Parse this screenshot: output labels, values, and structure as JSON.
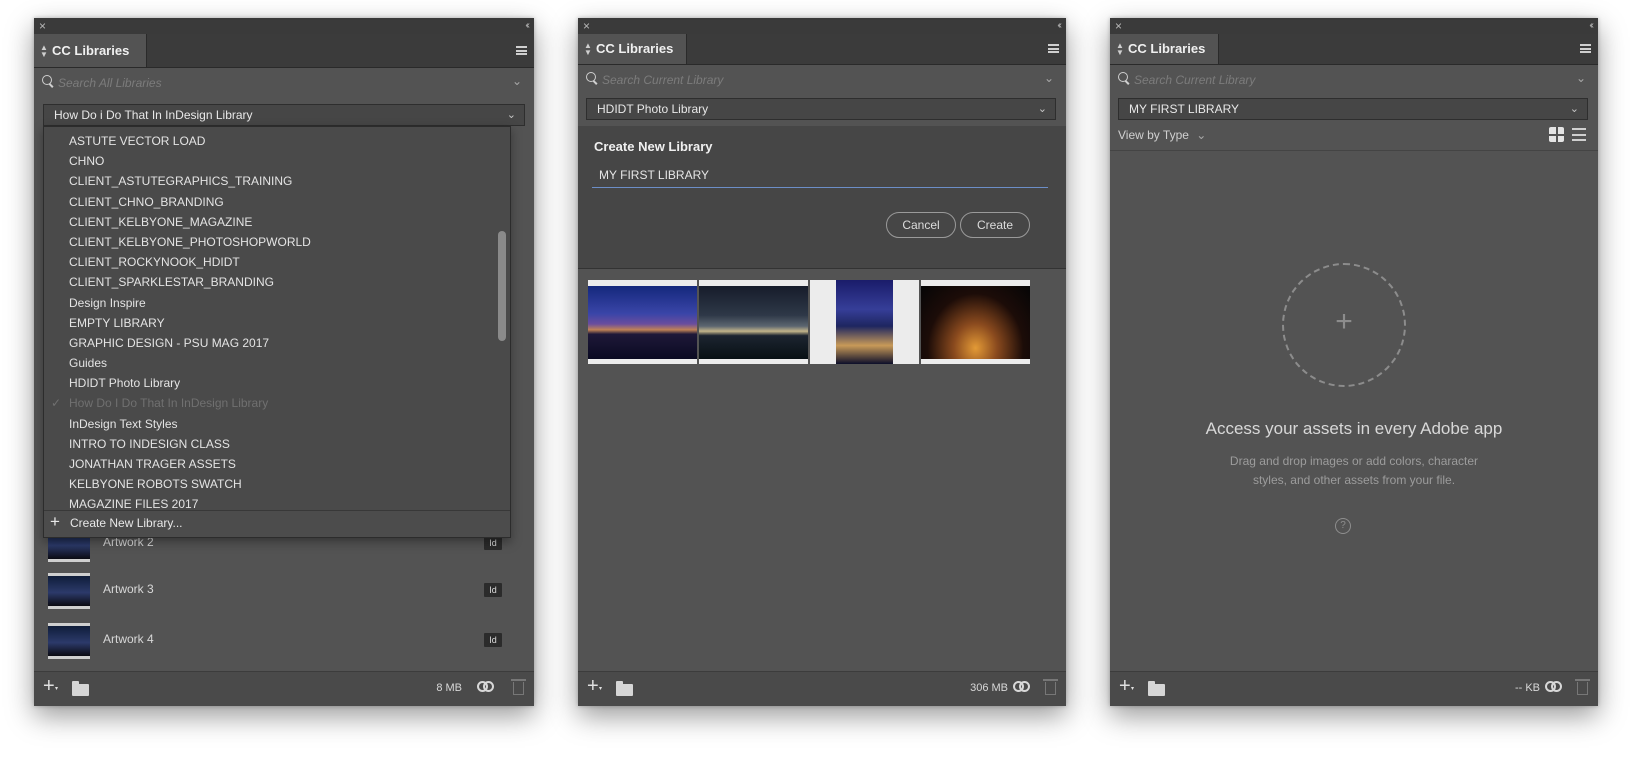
{
  "panel1": {
    "tab_label": "CC Libraries",
    "search_placeholder": "Search All Libraries",
    "selected_library": "How Do i Do That In InDesign Library",
    "dropdown_items": [
      {
        "label": "ASTUTE VECTOR LOAD"
      },
      {
        "label": "CHNO"
      },
      {
        "label": "CLIENT_ASTUTEGRAPHICS_TRAINING"
      },
      {
        "label": "CLIENT_CHNO_BRANDING"
      },
      {
        "label": "CLIENT_KELBYONE_MAGAZINE"
      },
      {
        "label": "CLIENT_KELBYONE_PHOTOSHOPWORLD"
      },
      {
        "label": "CLIENT_ROCKYNOOK_HDIDT"
      },
      {
        "label": "CLIENT_SPARKLESTAR_BRANDING"
      },
      {
        "label": "Design Inspire"
      },
      {
        "label": "EMPTY LIBRARY"
      },
      {
        "label": "GRAPHIC DESIGN - PSU MAG 2017"
      },
      {
        "label": "Guides"
      },
      {
        "label": "HDIDT Photo Library"
      },
      {
        "label": "How Do I Do That In InDesign Library",
        "checked": true
      },
      {
        "label": "InDesign Text Styles"
      },
      {
        "label": "INTRO TO INDESIGN CLASS"
      },
      {
        "label": "JONATHAN TRAGER ASSETS"
      },
      {
        "label": "KELBYONE ROBOTS SWATCH"
      },
      {
        "label": "MAGAZINE FILES 2017"
      }
    ],
    "create_new_label": "Create New Library...",
    "assets": [
      {
        "name": "Artwork 2",
        "badge": "Id"
      },
      {
        "name": "Artwork 3",
        "badge": "Id"
      },
      {
        "name": "Artwork 4",
        "badge": "Id"
      }
    ],
    "footer_size": "8 MB"
  },
  "panel2": {
    "tab_label": "CC Libraries",
    "search_placeholder": "Search Current Library",
    "selected_library": "HDIDT Photo Library",
    "dialog_title": "Create New Library",
    "dialog_input_value": "MY FIRST LIBRARY",
    "cancel_label": "Cancel",
    "create_label": "Create",
    "footer_size": "306 MB"
  },
  "panel3": {
    "tab_label": "CC Libraries",
    "search_placeholder": "Search Current Library",
    "selected_library": "MY FIRST LIBRARY",
    "view_by": "View by Type",
    "empty_title": "Access your assets in every Adobe app",
    "empty_desc": "Drag and drop images or add colors, character styles, and other assets from your file.",
    "help_glyph": "?",
    "footer_size": "-- KB"
  },
  "glyphs": {
    "close": "×",
    "collapse": "‹‹",
    "chevron": "⌄",
    "check": "✓",
    "plus": "+"
  }
}
